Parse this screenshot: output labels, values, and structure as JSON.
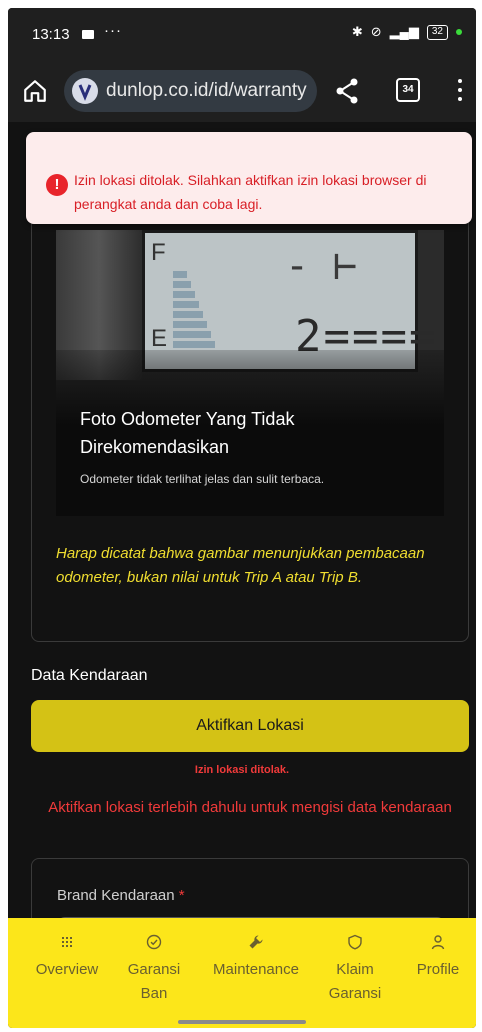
{
  "status_bar": {
    "time": "13:13",
    "dots": "···",
    "signal": "⁴ᴳ",
    "battery": "32"
  },
  "browser": {
    "url": "dunlop.co.id/id/warranty",
    "tab_count": "34"
  },
  "toast": {
    "message": "Izin lokasi ditolak. Silahkan aktifkan izin lokasi browser di perangkat anda dan coba lagi."
  },
  "odometer_example": {
    "title": "Foto Odometer Yang Tidak Direkomendasikan",
    "subtitle": "Odometer tidak terlihat jelas dan sulit terbaca.",
    "lcd_F": "F",
    "lcd_E": "E",
    "lcd_top": "- ⊢",
    "lcd_digits": "2====!"
  },
  "note": "Harap dicatat bahwa gambar menunjukkan pembacaan odometer, bukan nilai untuk Trip A atau Trip B.",
  "vehicle": {
    "section_title": "Data Kendaraan",
    "location_button": "Aktifkan Lokasi",
    "error_small": "Izin lokasi ditolak.",
    "error_big": "Aktifkan lokasi terlebih dahulu untuk mengisi data kendaraan",
    "brand_label": "Brand Kendaraan",
    "required_mark": "*"
  },
  "bottom_nav": {
    "items": [
      {
        "label": "Overview",
        "icon": "grid-icon"
      },
      {
        "label": "Garansi Ban",
        "icon": "check-circle-icon"
      },
      {
        "label": "Maintenance",
        "icon": "wrench-icon"
      },
      {
        "label": "Klaim Garansi",
        "icon": "shield-icon"
      },
      {
        "label": "Profile",
        "icon": "user-icon"
      }
    ]
  },
  "colors": {
    "accent_yellow": "#fce61a",
    "button_yellow": "#d4c215",
    "error_red": "#f03a3a",
    "note_yellow": "#f0de30"
  }
}
